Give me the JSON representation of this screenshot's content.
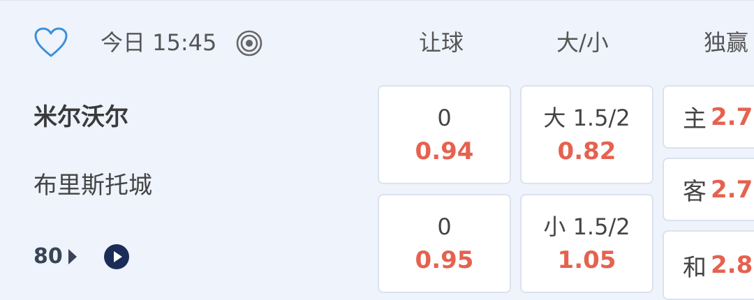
{
  "header": {
    "time": "今日 15:45",
    "columns": {
      "handicap": "让球",
      "over_under": "大/小",
      "one_x_two": "独赢"
    }
  },
  "match": {
    "home_team": "米尔沃尔",
    "away_team": "布里斯托城",
    "minute": "80"
  },
  "odds": {
    "handicap": {
      "home": {
        "line": "0",
        "price": "0.94"
      },
      "away": {
        "line": "0",
        "price": "0.95"
      }
    },
    "over_under": {
      "over": {
        "line": "大 1.5/2",
        "price": "0.82"
      },
      "under": {
        "line": "小 1.5/2",
        "price": "1.05"
      }
    },
    "one_x_two": {
      "home": {
        "label": "主",
        "price": "2.7"
      },
      "away": {
        "label": "客",
        "price": "2.7"
      },
      "draw": {
        "label": "和",
        "price": "2.8"
      }
    }
  },
  "colors": {
    "background": "#eef3fc",
    "accent_blue": "#3b8fd9",
    "odds_red": "#e5624f",
    "dark_navy": "#1c2c58"
  },
  "icons": {
    "favorite": "heart-outline-icon",
    "live_target": "target-icon",
    "expand": "arrow-right-icon",
    "video": "play-icon"
  }
}
